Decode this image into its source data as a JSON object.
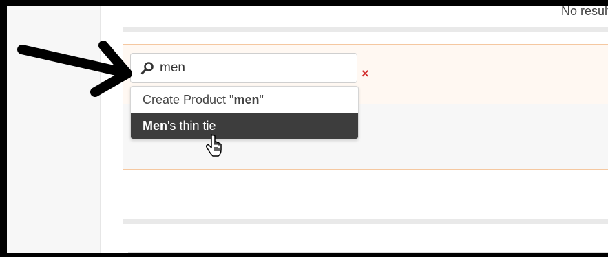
{
  "header": {
    "no_results_text": "No results"
  },
  "search": {
    "value": "men",
    "placeholder": ""
  },
  "clear": {
    "symbol": "×"
  },
  "dropdown": {
    "create": {
      "prefix": "Create Product \"",
      "term": "men",
      "suffix": "\""
    },
    "result": {
      "match": "Men",
      "rest": "'s thin tie"
    }
  },
  "icons": {
    "search": "magnifier-icon",
    "cursor": "hand-pointer-icon",
    "arrow": "annotation-arrow-icon"
  },
  "colors": {
    "accent_border": "#f5c8a1",
    "highlight_bg": "#3d3d3d",
    "clear_red": "#d32f2f"
  }
}
